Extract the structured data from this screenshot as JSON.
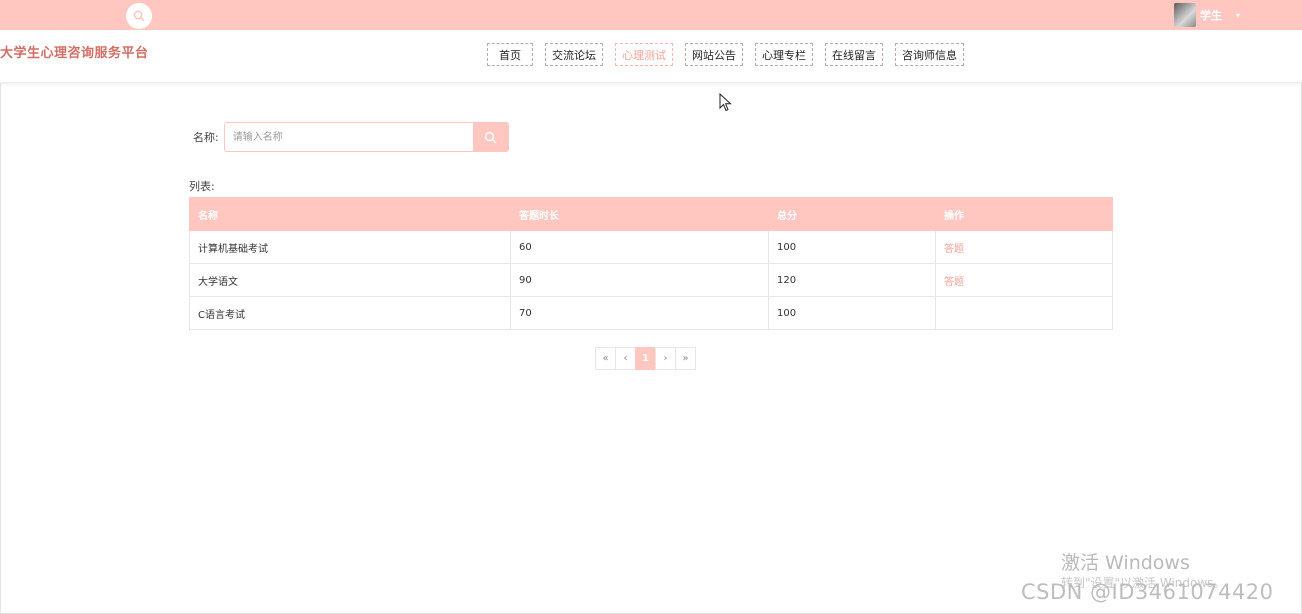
{
  "topbar": {
    "user_name": "学生",
    "caret": "▾"
  },
  "header": {
    "site_title": "大学生心理咨询服务平台",
    "nav": [
      {
        "label": "首页",
        "active": false
      },
      {
        "label": "交流论坛",
        "active": false
      },
      {
        "label": "心理测试",
        "active": true
      },
      {
        "label": "网站公告",
        "active": false
      },
      {
        "label": "心理专栏",
        "active": false
      },
      {
        "label": "在线留言",
        "active": false
      },
      {
        "label": "咨询师信息",
        "active": false
      }
    ]
  },
  "search": {
    "label": "名称:",
    "placeholder": "请输入名称",
    "value": ""
  },
  "list": {
    "label": "列表:",
    "columns": [
      "名称",
      "答题时长",
      "总分",
      "操作"
    ],
    "rows": [
      {
        "name": "计算机基础考试",
        "duration": "60",
        "score": "100",
        "action": "答题"
      },
      {
        "name": "大学语文",
        "duration": "90",
        "score": "120",
        "action": "答题"
      },
      {
        "name": "C语言考试",
        "duration": "70",
        "score": "100",
        "action": ""
      }
    ]
  },
  "pagination": {
    "first": "«",
    "prev": "‹",
    "current": "1",
    "next": "›",
    "last": "»"
  },
  "watermark": {
    "title": "激活 Windows",
    "subtitle": "转到\"设置\"以激活 Windows。",
    "csdn": "CSDN @ID3461074420"
  },
  "colors": {
    "accent": "#ffc7c0",
    "title": "#d16e66",
    "active_nav": "#f3a39a"
  },
  "icons": {
    "search": "search-icon",
    "cursor": "mouse-cursor-icon",
    "avatar": "avatar"
  }
}
